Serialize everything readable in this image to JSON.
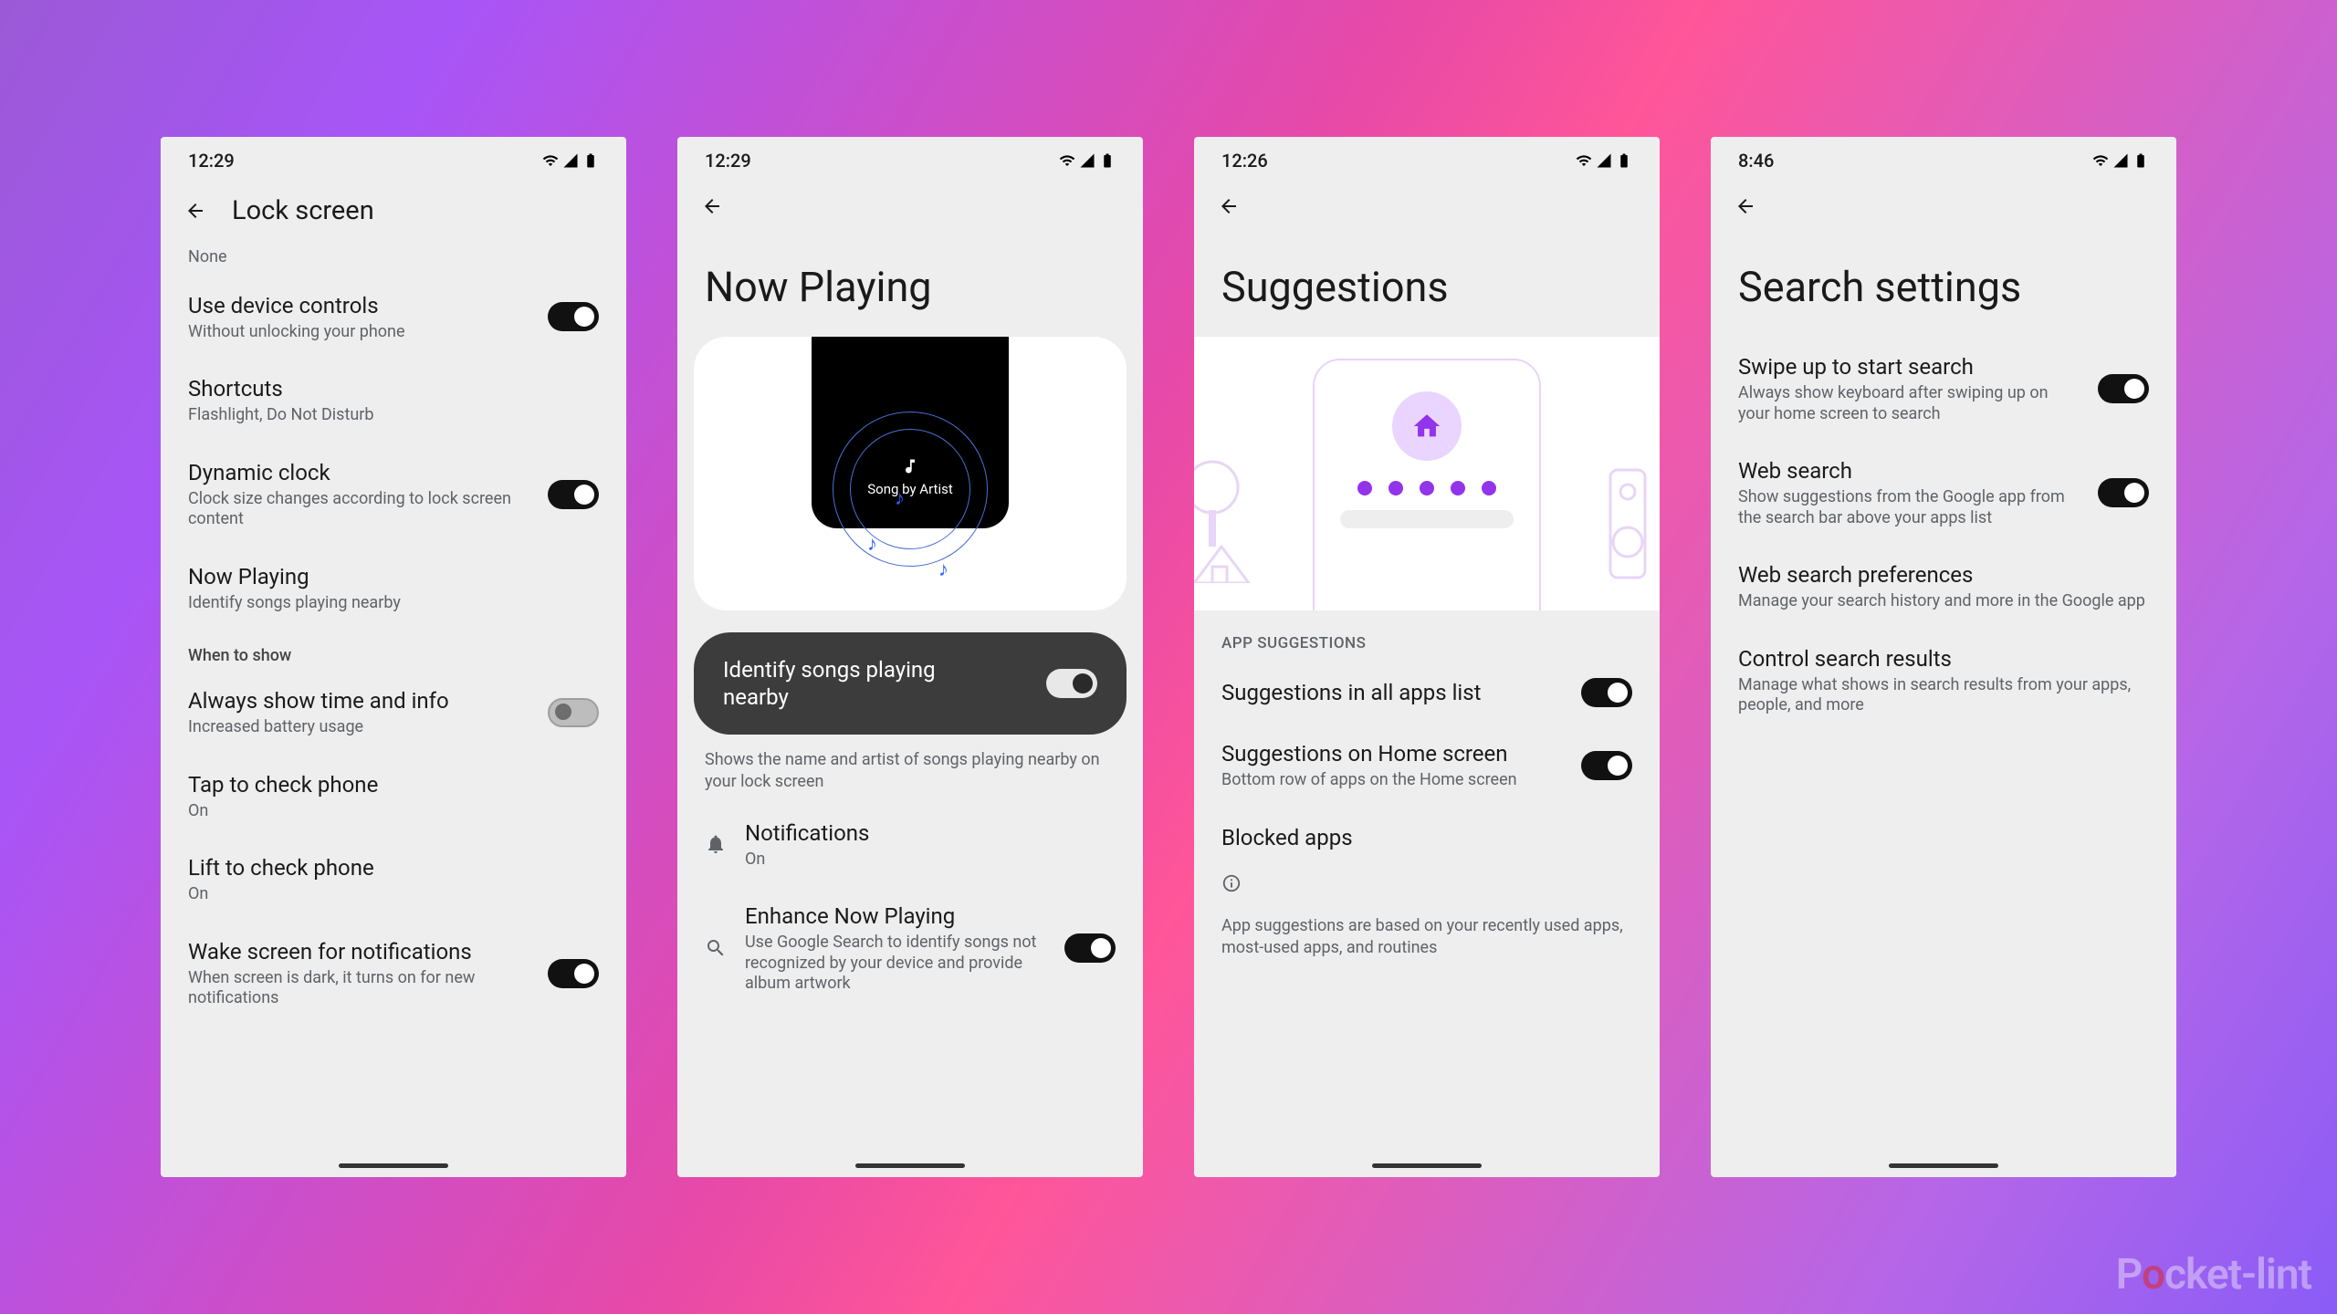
{
  "watermark_brand": "Pocket-lint",
  "screens": [
    {
      "time": "12:29",
      "title_inline": "Lock screen",
      "pre_row": "None",
      "rows": [
        {
          "title": "Use device controls",
          "sub": "Without unlocking your phone",
          "toggle": "on"
        },
        {
          "title": "Shortcuts",
          "sub": "Flashlight, Do Not Disturb"
        },
        {
          "title": "Dynamic clock",
          "sub": "Clock size changes according to lock screen content",
          "toggle": "on"
        },
        {
          "title": "Now Playing",
          "sub": "Identify songs playing nearby"
        }
      ],
      "section": "When to show",
      "rows2": [
        {
          "title": "Always show time and info",
          "sub": "Increased battery usage",
          "toggle": "off"
        },
        {
          "title": "Tap to check phone",
          "sub": "On"
        },
        {
          "title": "Lift to check phone",
          "sub": "On"
        },
        {
          "title": "Wake screen for notifications",
          "sub": "When screen is dark, it turns on for new notifications",
          "toggle": "on"
        }
      ]
    },
    {
      "time": "12:29",
      "large_title": "Now Playing",
      "phone_card_label": "Song by Artist",
      "identify": {
        "title": "Identify songs playing nearby",
        "toggle": "on"
      },
      "helper": "Shows the name and artist of songs playing nearby on your lock screen",
      "notif": {
        "title": "Notifications",
        "sub": "On"
      },
      "enhance": {
        "title": "Enhance Now Playing",
        "sub": "Use Google Search to identify songs not recognized by your device and provide album artwork",
        "toggle": "on"
      }
    },
    {
      "time": "12:26",
      "large_title": "Suggestions",
      "section": "APP SUGGESTIONS",
      "rows": [
        {
          "title": "Suggestions in all apps list",
          "toggle": "on"
        },
        {
          "title": "Suggestions on Home screen",
          "sub": "Bottom row of apps on the Home screen",
          "toggle": "on"
        },
        {
          "title": "Blocked apps"
        }
      ],
      "info": "App suggestions are based on your recently used apps, most-used apps, and routines"
    },
    {
      "time": "8:46",
      "large_title": "Search settings",
      "rows": [
        {
          "title": "Swipe up to start search",
          "sub": "Always show keyboard after swiping up on your home screen to search",
          "toggle": "on"
        },
        {
          "title": "Web search",
          "sub": "Show suggestions from the Google app from the search bar above your apps list",
          "toggle": "on"
        },
        {
          "title": "Web search preferences",
          "sub": "Manage your search history and more in the Google app"
        },
        {
          "title": "Control search results",
          "sub": "Manage what shows in search results from your apps, people, and more"
        }
      ]
    }
  ]
}
